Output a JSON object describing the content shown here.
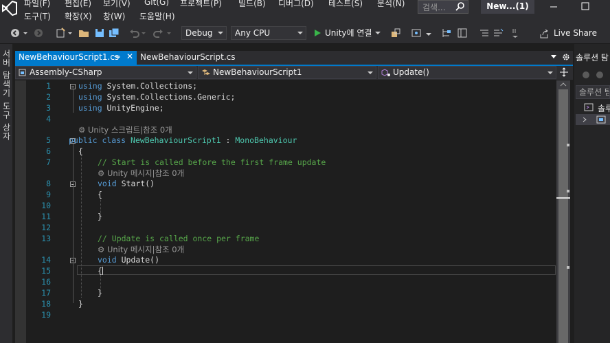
{
  "menu": {
    "row1": [
      "파일(F)",
      "편집(E)",
      "보기(V)",
      "Git(G)",
      "프로젝트(P)",
      "빌드(B)",
      "디버그(D)",
      "테스트(S)",
      "분석(N)"
    ],
    "row2": [
      "도구(T)",
      "확장(X)",
      "창(W)",
      "도움말(H)"
    ]
  },
  "search": {
    "placeholder": "검색..."
  },
  "solution_name": "New...(1)",
  "toolbar": {
    "configuration": "Debug",
    "platform": "Any CPU",
    "run_label": "Unity에 연결",
    "live_share": "Live Share"
  },
  "left_tabs": [
    "서버 탐색기",
    "도구 상자"
  ],
  "tabs": [
    {
      "label": "NewBehaviourScript1.cs",
      "active": true
    },
    {
      "label": "NewBehaviourScript.cs",
      "active": false
    }
  ],
  "navbar": {
    "project": "Assembly-CSharp",
    "class": "NewBehaviourScript1",
    "member": "Update()"
  },
  "code_lines": [
    {
      "n": "1"
    },
    {
      "n": "2"
    },
    {
      "n": "3"
    },
    {
      "n": "4"
    },
    {
      "n": "5"
    },
    {
      "n": "6"
    },
    {
      "n": "7"
    },
    {
      "n": "8"
    },
    {
      "n": "9"
    },
    {
      "n": "10"
    },
    {
      "n": "11"
    },
    {
      "n": "12"
    },
    {
      "n": "13"
    },
    {
      "n": "14"
    },
    {
      "n": "15"
    },
    {
      "n": "16"
    },
    {
      "n": "17"
    },
    {
      "n": "18"
    },
    {
      "n": "19"
    }
  ],
  "code": {
    "l1_kw": "using",
    "l1_rest": " System.Collections;",
    "l2_kw": "using",
    "l2_rest": " System.Collections.Generic;",
    "l3_kw": "using",
    "l3_rest": " UnityEngine;",
    "lens_class": "Unity 스크립트|참조 0개",
    "l5_kw": "public class",
    "l5_name": " NewBehaviourScript1",
    "l5_colon": " : ",
    "l5_base": "MonoBehaviour",
    "l6": "{",
    "l7_comment": "// Start is called before the first frame update",
    "lens_start": "Unity 메시지|참조 0개",
    "l8_kw": "void",
    "l8_rest": " Start()",
    "l9": "{",
    "l11": "}",
    "l13_comment": "// Update is called once per frame",
    "lens_update": "Unity 메시지|참조 0개",
    "l14_kw": "void",
    "l14_rest": " Update()",
    "l15": "{",
    "l17": "}",
    "l18": "}"
  },
  "right_panel": {
    "title": "솔루션 탐",
    "search": "솔루션 탐",
    "item1": "솔루"
  },
  "colors": {
    "accent": "#007acc",
    "keyword": "#569cd6",
    "type": "#4ec9b0",
    "comment": "#57a64a",
    "line_number": "#2b91af"
  }
}
